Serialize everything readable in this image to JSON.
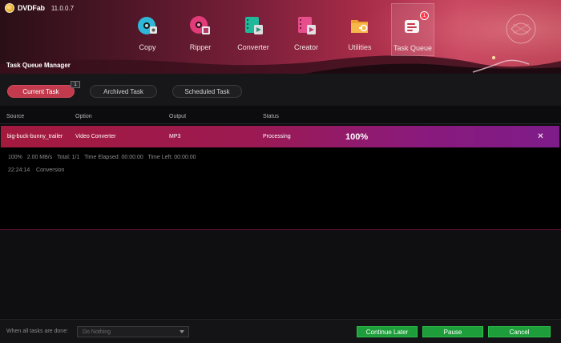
{
  "app": {
    "name": "DVDFab",
    "version": "11.0.0.7"
  },
  "nav": [
    {
      "id": "copy",
      "label": "Copy",
      "icon": "disc-copy-icon",
      "active": false
    },
    {
      "id": "ripper",
      "label": "Ripper",
      "icon": "disc-ripper-icon",
      "active": false
    },
    {
      "id": "converter",
      "label": "Converter",
      "icon": "film-converter-icon",
      "active": false
    },
    {
      "id": "creator",
      "label": "Creator",
      "icon": "film-creator-icon",
      "active": false
    },
    {
      "id": "utilities",
      "label": "Utilities",
      "icon": "folder-utilities-icon",
      "active": false
    },
    {
      "id": "task_queue",
      "label": "Task Queue",
      "icon": "task-queue-icon",
      "active": true,
      "badge": "1"
    }
  ],
  "section_title": "Task Queue Manager",
  "tabs": [
    {
      "label": "Current Task",
      "active": true,
      "badge": "1"
    },
    {
      "label": "Archived Task",
      "active": false
    },
    {
      "label": "Scheduled Task",
      "active": false
    }
  ],
  "table": {
    "headers": {
      "source": "Source",
      "option": "Option",
      "output": "Output",
      "status": "Status"
    },
    "rows": [
      {
        "source": "big-buck-bunny_trailer",
        "option": "Video Converter",
        "output": "MP3",
        "status": "Processing",
        "progress": "100%"
      }
    ]
  },
  "detail": {
    "line1": "100%   2.00 MB/s   Total: 1/1   Time Elapsed: 00:00:00   Time Left: 00:00:00",
    "line2": "22:24:14    Conversion"
  },
  "footer": {
    "when_done_label": "When all tasks are done:",
    "when_done_value": "Do Nothing",
    "continue_later": "Continue Later",
    "pause": "Pause",
    "cancel": "Cancel"
  },
  "colors": {
    "accent": "#c23a4c",
    "row_start": "#a31a3d",
    "row_end": "#7e1c8a",
    "button_green": "#1e9e3a"
  }
}
